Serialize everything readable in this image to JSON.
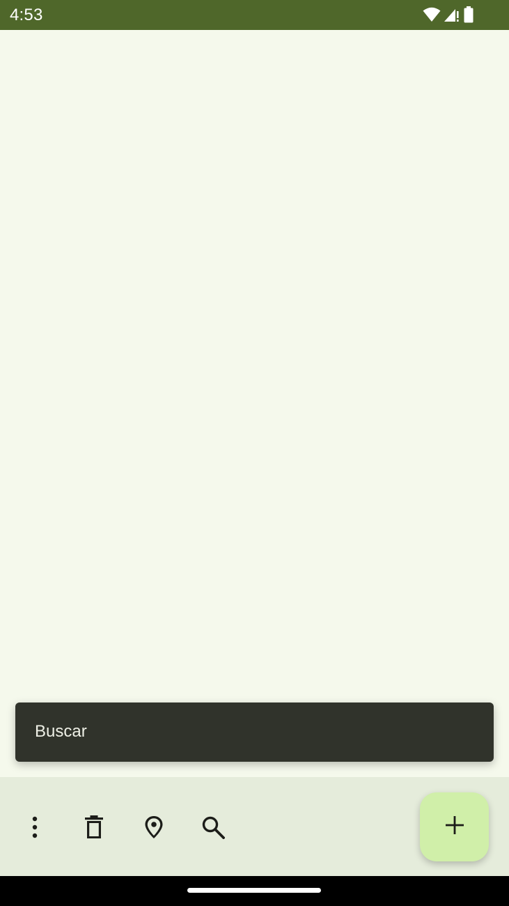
{
  "status_bar": {
    "time": "4:53",
    "background": "#4f672a",
    "icons": [
      "wifi-icon",
      "cell-signal-icon",
      "battery-icon"
    ]
  },
  "content": {
    "background": "#f5f9ec"
  },
  "snackbar": {
    "text": "Buscar",
    "background": "#30332b"
  },
  "bottom_bar": {
    "background": "#e5ecdb",
    "actions": [
      {
        "icon": "more-vert-icon"
      },
      {
        "icon": "delete-icon"
      },
      {
        "icon": "location-pin-icon"
      },
      {
        "icon": "search-icon"
      }
    ],
    "fab": {
      "icon": "add-icon",
      "background": "#d0efa9"
    }
  },
  "nav_bar": {
    "background": "#000000"
  }
}
